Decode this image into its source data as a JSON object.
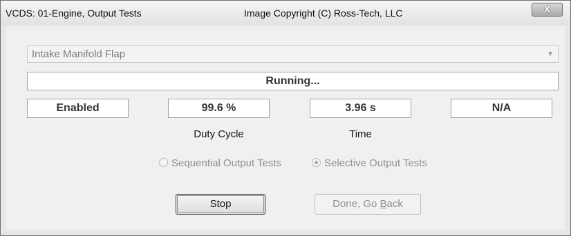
{
  "titlebar": {
    "left_title": "VCDS: 01-Engine,  Output Tests",
    "center_title": "Image Copyright (C) Ross-Tech, LLC",
    "close_label": "X"
  },
  "dropdown": {
    "selected": "Intake Manifold Flap",
    "arrow_icon": "chevron-down-icon"
  },
  "status": {
    "text": "Running..."
  },
  "readouts": {
    "enabled": "Enabled",
    "duty_cycle_value": "99.6 %",
    "time_value": "3.96 s",
    "na_value": "N/A",
    "duty_cycle_label": "Duty Cycle",
    "time_label": "Time"
  },
  "test_mode": {
    "sequential_label": "Sequential Output Tests",
    "selective_label": "Selective Output Tests",
    "selected": "Selective Output Tests"
  },
  "buttons": {
    "stop_label": "Stop",
    "done_prefix": "Done, Go ",
    "done_accel": "B",
    "done_suffix": "ack"
  }
}
